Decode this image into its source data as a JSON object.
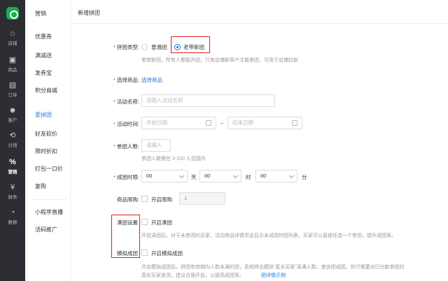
{
  "nav": {
    "items": [
      {
        "label": "店铺",
        "icon": "home-icon"
      },
      {
        "label": "商品",
        "icon": "box-icon"
      },
      {
        "label": "订单",
        "icon": "document-icon"
      },
      {
        "label": "客户",
        "icon": "people-icon"
      },
      {
        "label": "分销",
        "icon": "share-icon"
      },
      {
        "label": "营销",
        "icon": "percent-icon"
      },
      {
        "label": "财务",
        "icon": "yen-icon"
      },
      {
        "label": "数据",
        "icon": "pie-chart-icon"
      }
    ],
    "active": "营销"
  },
  "sub_nav": {
    "heading": "营销",
    "items": [
      "优惠券",
      "满减送",
      "发券宝",
      "积分商城",
      "爱拼团",
      "好友砍价",
      "限时折扣",
      "打包一口价",
      "复购",
      "小程序直播",
      "活码推广"
    ],
    "active": "爱拼团"
  },
  "page": {
    "title": "新增拼团"
  },
  "form": {
    "group_type": {
      "label": "拼团类型:",
      "options": [
        "普通团",
        "老带新团"
      ],
      "selected": "老带新团",
      "hint": "老带新团，所有人都能开团，只有店铺新客户才能参团，可用于店铺拉新"
    },
    "product": {
      "label": "选择商品:",
      "link": "选择商品"
    },
    "name": {
      "label": "活动名称:",
      "placeholder": "请输入活动名称"
    },
    "time": {
      "label": "活动时间:",
      "start_placeholder": "开始日期",
      "separator": "~",
      "end_placeholder": "结束日期"
    },
    "members": {
      "label": "参团人数:",
      "placeholder": "请输入",
      "hint": "参团人数需在 2-100 人范围内"
    },
    "duration": {
      "label": "成团时限:",
      "day": "00",
      "day_unit": "天",
      "hour": "00",
      "hour_unit": "时",
      "minute": "00",
      "minute_unit": "分"
    },
    "limit": {
      "label": "商品限购:",
      "checkbox": "开启限购",
      "value": "1"
    },
    "auto_group": {
      "label": "凑团设置",
      "checkbox": "开启凑团",
      "hint": "开启凑团后，对于未参团的买家，活动商品详情页会显示未成团的团列表，买家可以直接任选一个参团，提升成团率。"
    },
    "mock_group": {
      "label": "模拟成团",
      "checkbox": "开启模拟成团",
      "hint_line1": "开启模拟成团后，拼团有效期内人数未满的团，系统将会模拟“匿名买家”凑满人数，使该团成团。你只需要对已付款参团的",
      "hint_line2": "真实买家发货。建议合理开启，以提高成团率。",
      "link": "团详情示例"
    }
  },
  "colors": {
    "accent": "#1677e4",
    "highlight": "#e02020",
    "nav_bg": "#2d2e33",
    "brand": "#1aae4f"
  }
}
